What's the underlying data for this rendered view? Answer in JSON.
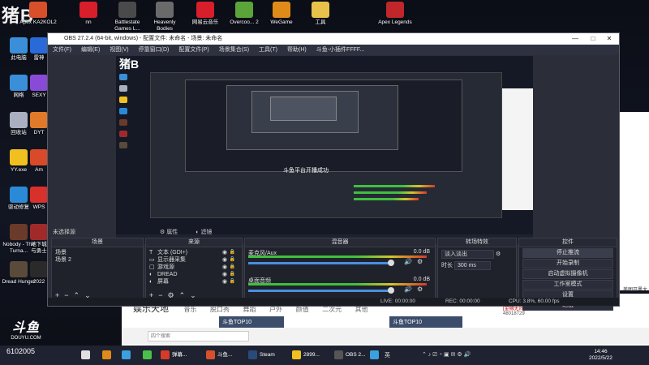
{
  "colors": {
    "accent": "#4a8fe0",
    "meter_green": "#3fbf3f",
    "meter_yellow": "#d4c32a",
    "meter_red": "#d43a2a"
  },
  "watermark": "猪B",
  "desktop_icons": [
    {
      "label": "Apex KA2KOL2",
      "color": "#d8502a"
    },
    {
      "label": "nn",
      "color": "#d81e2a"
    },
    {
      "label": "Battlestate Games L...",
      "color": "#4a4a4a"
    },
    {
      "label": "Heavenly Bodies",
      "color": "#6a6a6a"
    },
    {
      "label": "网易云音乐",
      "color": "#d81e2a"
    },
    {
      "label": "Overcoo... 2",
      "color": "#5aa43a"
    },
    {
      "label": "WeGame",
      "color": "#e08a1a"
    },
    {
      "label": "工具",
      "color": "#e8c24a"
    },
    {
      "label": "Apex Legends",
      "color": "#c0262a"
    }
  ],
  "left_icons": [
    {
      "label": "此电脑",
      "color": "#3a8fd8"
    },
    {
      "label": "雷神",
      "color": "#2a6ad8"
    },
    {
      "label": "网络",
      "color": "#3a8fd8"
    },
    {
      "label": "SEXY",
      "color": "#8a4ad8"
    },
    {
      "label": "回收站",
      "color": "#aab0c0"
    },
    {
      "label": "DYT",
      "color": "#e07a2a"
    },
    {
      "label": "YY.exe",
      "color": "#f0c020"
    },
    {
      "label": "Am",
      "color": "#d84a2a"
    },
    {
      "label": "驱动修复",
      "color": "#2a8ad8"
    },
    {
      "label": "WPS",
      "color": "#d8302a"
    },
    {
      "label": "Nobody - The Turna...",
      "color": "#6a3a2a"
    },
    {
      "label": "地下城与勇士",
      "color": "#a02a2a"
    },
    {
      "label": "Dread Hunger",
      "color": "#5a4a3a"
    },
    {
      "label": "2022",
      "color": "#2a2a2a"
    }
  ],
  "douyu": {
    "logo": "斗鱼",
    "url": "DOUYU.COM",
    "room": "6102005"
  },
  "obs": {
    "title": "OBS 27.2.4 (64-bit, windows) - 配置文件: 未命名 - 场景: 未命名",
    "menu": [
      "文件(F)",
      "编辑(E)",
      "视图(V)",
      "停靠窗口(D)",
      "配置文件(P)",
      "场景集合(S)",
      "工具(T)",
      "帮助(H)",
      "斗鱼-小插件FFFF..."
    ],
    "preview_title": "斗鱼平台开播成功",
    "no_source": "未选择源",
    "props": "属性",
    "filters": "滤镜",
    "scenes_header": "场景",
    "scenes": [
      "场景",
      "场景 2"
    ],
    "sources_header": "来源",
    "sources": [
      {
        "icon": "T",
        "name": "文本 (GDI+)"
      },
      {
        "icon": "▭",
        "name": "显示器采集"
      },
      {
        "icon": "▢",
        "name": "游戏源"
      },
      {
        "icon": "◐",
        "name": "DREAD"
      },
      {
        "icon": "◐",
        "name": "屏幕"
      }
    ],
    "mixer_header": "混音器",
    "mixer": [
      {
        "name": "麦克风/Aux",
        "db": "0.0 dB"
      },
      {
        "name": "桌面音频",
        "db": "0.0 dB"
      }
    ],
    "transitions_header": "转场特效",
    "transition_type": "淡入淡出",
    "duration_label": "时长",
    "duration": "300 ms",
    "controls_header": "控件",
    "controls": [
      "停止推流",
      "开始录制",
      "启动虚拟摄像机",
      "工作室模式",
      "设置",
      "退出"
    ],
    "status": {
      "live": "LIVE: 00:00:00",
      "rec": "REC: 00:00:00",
      "cpu": "CPU: 3.8%, 60.00 fps"
    },
    "window_controls": [
      "—",
      "□",
      "✕"
    ]
  },
  "promo": {
    "main": "娱乐天地",
    "cats": [
      "音乐",
      "脱口秀",
      "舞蹈",
      "户外",
      "颜值",
      "二次元",
      "其他"
    ],
    "thumbs": [
      "斗鱼TOP10",
      "斗鱼TOP10"
    ],
    "search_placeholder": "四个搜索",
    "ad": "[金融无间] 全网第一开局",
    "ad_id": "48018729",
    "side": "美图开黑大神公"
  },
  "taskbar": {
    "items": [
      {
        "label": "",
        "color": "#e0e0e0"
      },
      {
        "label": "",
        "color": "#e08a1a"
      },
      {
        "label": "",
        "color": "#3aa0e0"
      },
      {
        "label": "",
        "color": "#4ac04a"
      },
      {
        "label": "弹幕...",
        "color": "#d83a2a"
      },
      {
        "label": "斗鱼...",
        "color": "#d8502a"
      },
      {
        "label": "Steam",
        "color": "#2a4a7a"
      },
      {
        "label": "2899...",
        "color": "#f0c020"
      },
      {
        "label": "OBS 2...",
        "color": "#555"
      },
      {
        "label": "",
        "color": "#3aa0e0"
      }
    ],
    "lang": "英",
    "time": "14:46",
    "date": "2022/5/22"
  }
}
